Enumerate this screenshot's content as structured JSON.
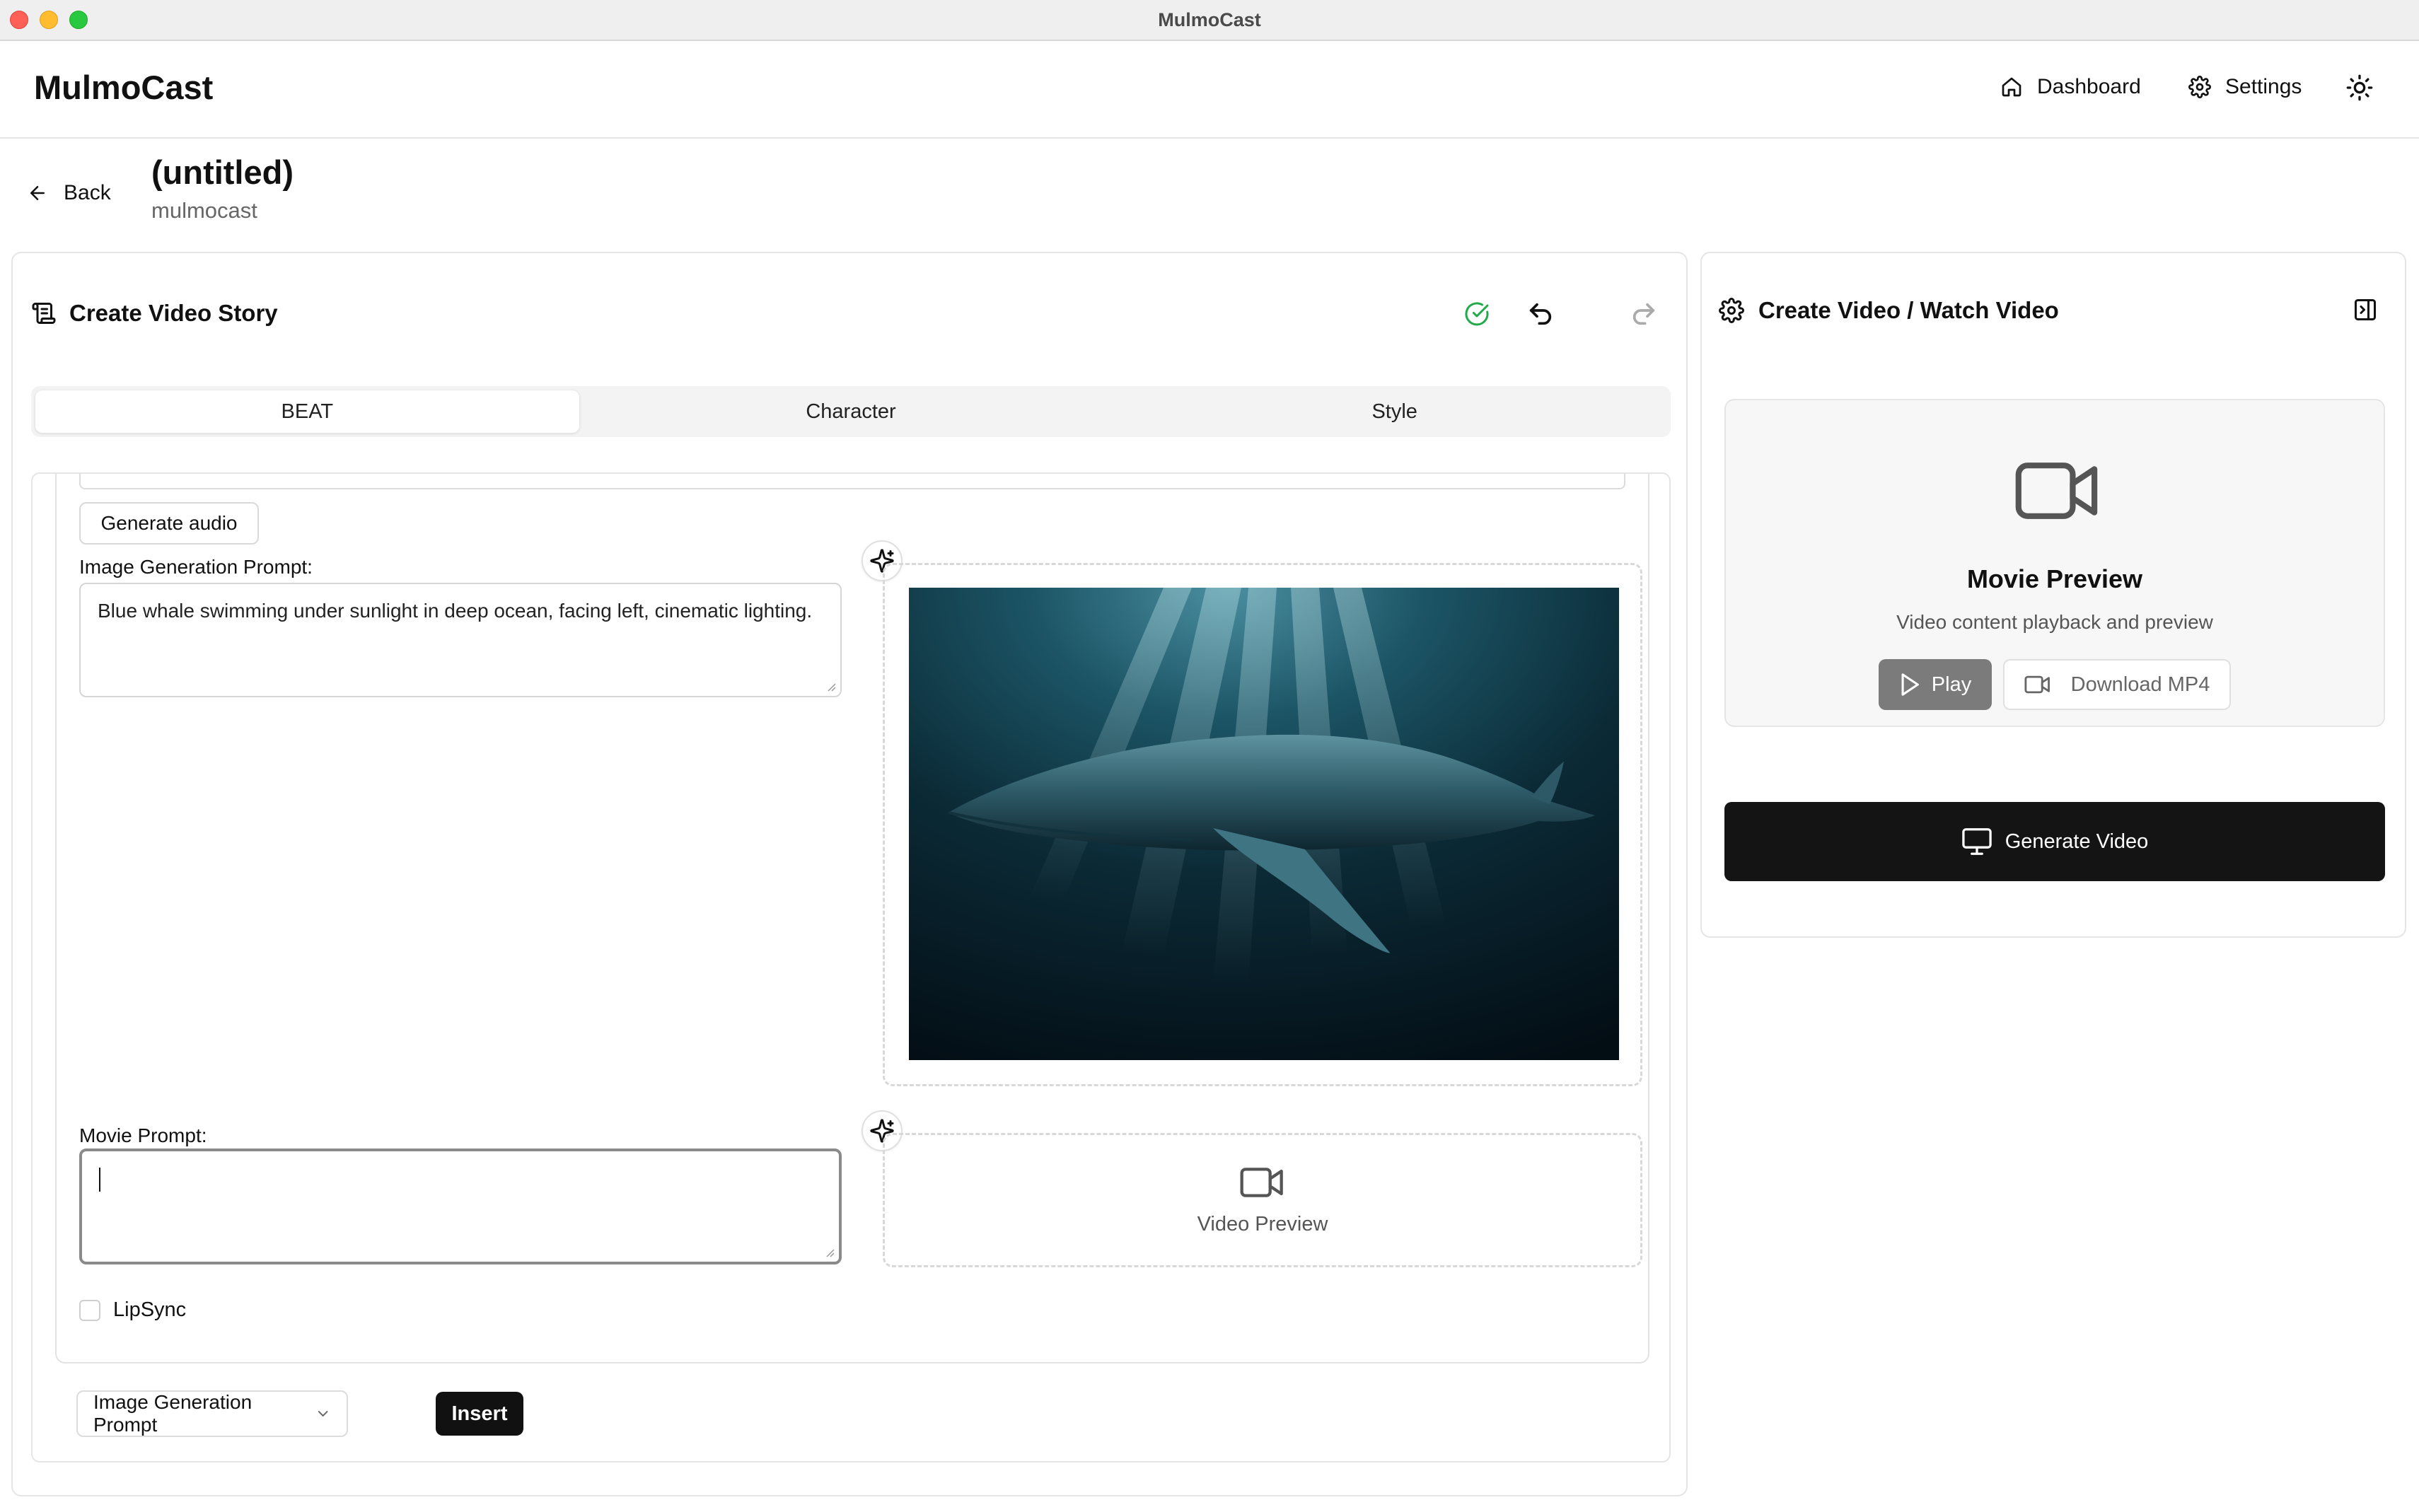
{
  "window": {
    "title": "MulmoCast"
  },
  "header": {
    "brand": "MulmoCast",
    "nav": {
      "dashboard": "Dashboard",
      "settings": "Settings"
    }
  },
  "project": {
    "back_label": "Back",
    "title": "(untitled)",
    "subtitle": "mulmocast"
  },
  "editor": {
    "heading": "Create Video Story",
    "tabs": [
      {
        "label": "BEAT",
        "active": true
      },
      {
        "label": "Character",
        "active": false
      },
      {
        "label": "Style",
        "active": false
      }
    ],
    "beat": {
      "generate_audio_label": "Generate audio",
      "image_prompt_label": "Image Generation Prompt:",
      "image_prompt_value": "Blue whale swimming under sunlight in deep ocean, facing left, cinematic lighting.",
      "movie_prompt_label": "Movie Prompt:",
      "movie_prompt_value": "",
      "video_preview_label": "Video Preview",
      "lipsync_label": "LipSync",
      "lipsync_checked": false
    },
    "footer": {
      "select_value": "Image Generation Prompt",
      "insert_label": "Insert"
    }
  },
  "right_panel": {
    "heading": "Create Video / Watch Video",
    "preview_title": "Movie Preview",
    "preview_subtitle": "Video content playback and preview",
    "play_label": "Play",
    "download_label": "Download MP4",
    "generate_label": "Generate Video"
  },
  "colors": {
    "primary_button": "#141414",
    "status_ok": "#22a94a",
    "play_button": "#7b7b7b"
  }
}
